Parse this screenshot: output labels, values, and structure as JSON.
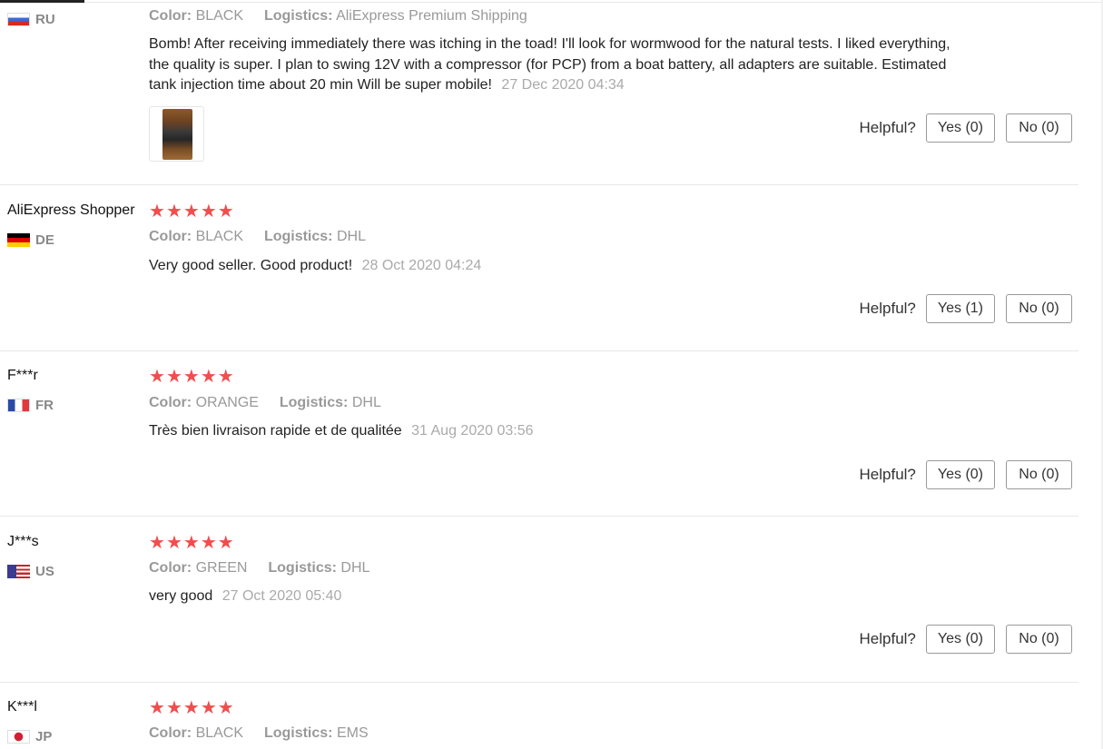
{
  "ui": {
    "color_label": "Color:",
    "logistics_label": "Logistics:",
    "helpful_label": "Helpful?"
  },
  "colors": {
    "star": "#f04e4e",
    "divider": "#e8e8e8",
    "muted": "#999999"
  },
  "reviews": [
    {
      "name": "",
      "country": "RU",
      "flag": "russia-flag-icon",
      "rating": 5,
      "color": "BLACK",
      "logistics": "AliExpress Premium Shipping",
      "text": "Bomb! After receiving immediately there was itching in the toad! I'll look for wormwood for the natural tests. I liked everything, the quality is super. I plan to swing 12V with a compressor (for PCP) from a boat battery, all adapters are suitable. Estimated tank injection time about 20 min Will be super mobile!",
      "date": "27 Dec 2020 04:34",
      "yes": "Yes (0)",
      "no": "No (0)"
    },
    {
      "name": "AliExpress Shopper",
      "country": "DE",
      "flag": "germany-flag-icon",
      "rating": 5,
      "color": "BLACK",
      "logistics": "DHL",
      "text": "Very good seller. Good product!",
      "date": "28 Oct 2020 04:24",
      "yes": "Yes (1)",
      "no": "No (0)"
    },
    {
      "name": "F***r",
      "country": "FR",
      "flag": "france-flag-icon",
      "rating": 5,
      "color": "ORANGE",
      "logistics": "DHL",
      "text": "Très bien livraison rapide et de qualitée",
      "date": "31 Aug 2020 03:56",
      "yes": "Yes (0)",
      "no": "No (0)"
    },
    {
      "name": "J***s",
      "country": "US",
      "flag": "usa-flag-icon",
      "rating": 5,
      "color": "GREEN",
      "logistics": "DHL",
      "text": "very good",
      "date": "27 Oct 2020 05:40",
      "yes": "Yes (0)",
      "no": "No (0)"
    },
    {
      "name": "K***l",
      "country": "JP",
      "flag": "japan-flag-icon",
      "rating": 5,
      "color": "BLACK",
      "logistics": "EMS",
      "text": "",
      "date": "",
      "yes": "",
      "no": ""
    }
  ]
}
